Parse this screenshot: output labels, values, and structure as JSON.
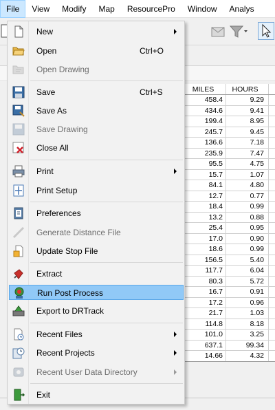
{
  "menubar": {
    "items": [
      {
        "label": "File"
      },
      {
        "label": "View"
      },
      {
        "label": "Modify"
      },
      {
        "label": "Map"
      },
      {
        "label": "ResourcePro"
      },
      {
        "label": "Window"
      },
      {
        "label": "Analys"
      }
    ]
  },
  "toolbar": {
    "icons": [
      "new-doc-icon",
      "email-icon",
      "filter-dropdown-icon",
      "pointer-select-icon"
    ]
  },
  "grid": {
    "columns": [
      "MILES",
      "HOURS"
    ],
    "rows": [
      [
        "458.4",
        "9.29"
      ],
      [
        "434.6",
        "9.41"
      ],
      [
        "199.4",
        "8.95"
      ],
      [
        "245.7",
        "9.45"
      ],
      [
        "136.6",
        "7.18"
      ],
      [
        "235.9",
        "7.47"
      ],
      [
        "95.5",
        "4.75"
      ],
      [
        "15.7",
        "1.07"
      ],
      [
        "84.1",
        "4.80"
      ],
      [
        "12.7",
        "0.77"
      ],
      [
        "18.4",
        "0.99"
      ],
      [
        "13.2",
        "0.88"
      ],
      [
        "25.4",
        "0.95"
      ],
      [
        "17.0",
        "0.90"
      ],
      [
        "18.6",
        "0.99"
      ],
      [
        "156.5",
        "5.40"
      ],
      [
        "117.7",
        "6.04"
      ],
      [
        "80.3",
        "5.72"
      ],
      [
        "16.7",
        "0.91"
      ],
      [
        "17.2",
        "0.96"
      ],
      [
        "21.7",
        "1.03"
      ],
      [
        "114.8",
        "8.18"
      ],
      [
        "101.0",
        "3.25"
      ],
      [
        "637.1",
        "99.34"
      ],
      [
        "14.66",
        "4.32"
      ]
    ]
  },
  "file_menu": {
    "new": "New",
    "open": "Open",
    "open_shortcut": "Ctrl+O",
    "open_drawing": "Open Drawing",
    "save": "Save",
    "save_shortcut": "Ctrl+S",
    "save_as": "Save As",
    "save_drawing": "Save Drawing",
    "close_all": "Close All",
    "print": "Print",
    "print_setup": "Print Setup",
    "preferences": "Preferences",
    "generate_distance": "Generate Distance File",
    "update_stop": "Update Stop File",
    "extract": "Extract",
    "run_post": "Run Post Process",
    "export_drtrack": "Export to DRTrack",
    "recent_files": "Recent Files",
    "recent_projects": "Recent Projects",
    "recent_user_data": "Recent User Data Directory",
    "exit": "Exit"
  },
  "colors": {
    "highlight": "#91c9f7",
    "menubar_active": "#cce8ff",
    "disabled_text": "#6d6d6d"
  }
}
